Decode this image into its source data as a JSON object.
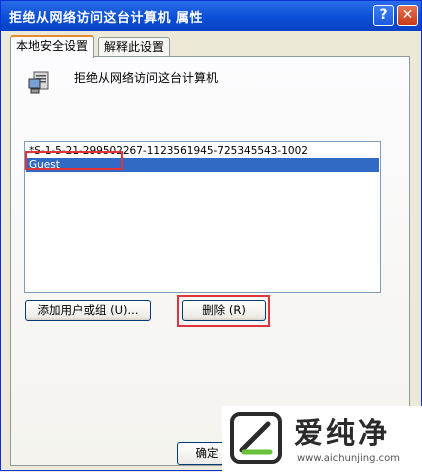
{
  "window": {
    "title": "拒绝从网络访问这台计算机 属性",
    "help_glyph": "?",
    "close_glyph": "✕"
  },
  "tabs": [
    {
      "label": "本地安全设置",
      "active": true
    },
    {
      "label": "解释此设置",
      "active": false
    }
  ],
  "policy": {
    "icon": "policy-computer-icon",
    "title": "拒绝从网络访问这台计算机"
  },
  "list": {
    "items": [
      {
        "text": "*S-1-5-21-299502267-1123561945-725345543-1002",
        "selected": false
      },
      {
        "text": "Guest",
        "selected": true
      }
    ]
  },
  "buttons": {
    "add": "添加用户或组 (U)...",
    "remove": "删除 (R)",
    "ok": "确定"
  },
  "annotations": {
    "highlight_color": "#e0333c"
  },
  "watermark": {
    "text": "爱纯净",
    "url": "www.aichunjing.com"
  }
}
